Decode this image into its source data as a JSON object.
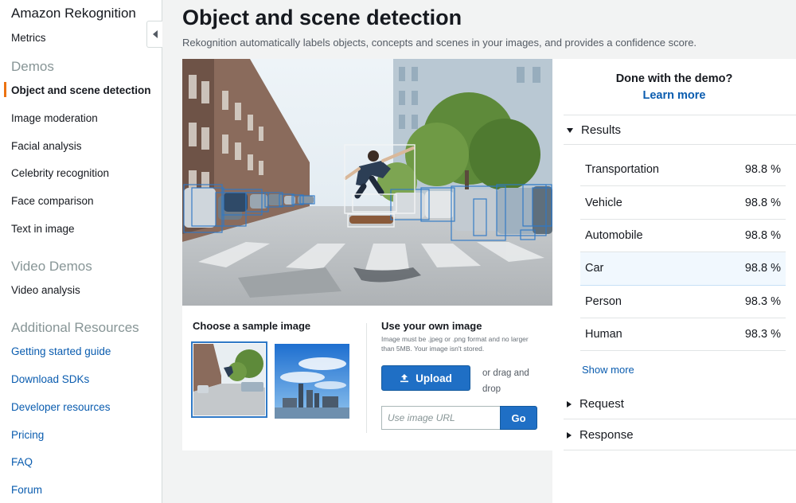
{
  "sidebar": {
    "title": "Amazon Rekognition",
    "metrics": "Metrics",
    "demos_heading": "Demos",
    "demos": [
      "Object and scene detection",
      "Image moderation",
      "Facial analysis",
      "Celebrity recognition",
      "Face comparison",
      "Text in image"
    ],
    "video_heading": "Video Demos",
    "video_items": [
      "Video analysis"
    ],
    "resources_heading": "Additional Resources",
    "resources": [
      "Getting started guide",
      "Download SDKs",
      "Developer resources",
      "Pricing",
      "FAQ",
      "Forum"
    ]
  },
  "header": {
    "title": "Object and scene detection",
    "subtitle": "Rekognition automatically labels objects, concepts and scenes in your images, and provides a confidence score."
  },
  "sample": {
    "heading": "Choose a sample image"
  },
  "upload": {
    "heading": "Use your own image",
    "note": "Image must be .jpeg or .png format and no larger than 5MB. Your image isn't stored.",
    "button": "Upload",
    "drag_text": "or drag and drop",
    "url_placeholder": "Use image URL",
    "go": "Go"
  },
  "right": {
    "done": "Done with the demo?",
    "learn_more": "Learn more",
    "results_label": "Results",
    "results": [
      {
        "label": "Transportation",
        "score": "98.8 %"
      },
      {
        "label": "Vehicle",
        "score": "98.8 %"
      },
      {
        "label": "Automobile",
        "score": "98.8 %"
      },
      {
        "label": "Car",
        "score": "98.8 %"
      },
      {
        "label": "Person",
        "score": "98.3 %"
      },
      {
        "label": "Human",
        "score": "98.3 %"
      }
    ],
    "show_more": "Show more",
    "request_label": "Request",
    "response_label": "Response"
  },
  "colors": {
    "accent_orange": "#ec7211",
    "link_blue": "#0a5caf",
    "button_blue": "#1f6fc5",
    "box_blue": "#2f79c6"
  }
}
